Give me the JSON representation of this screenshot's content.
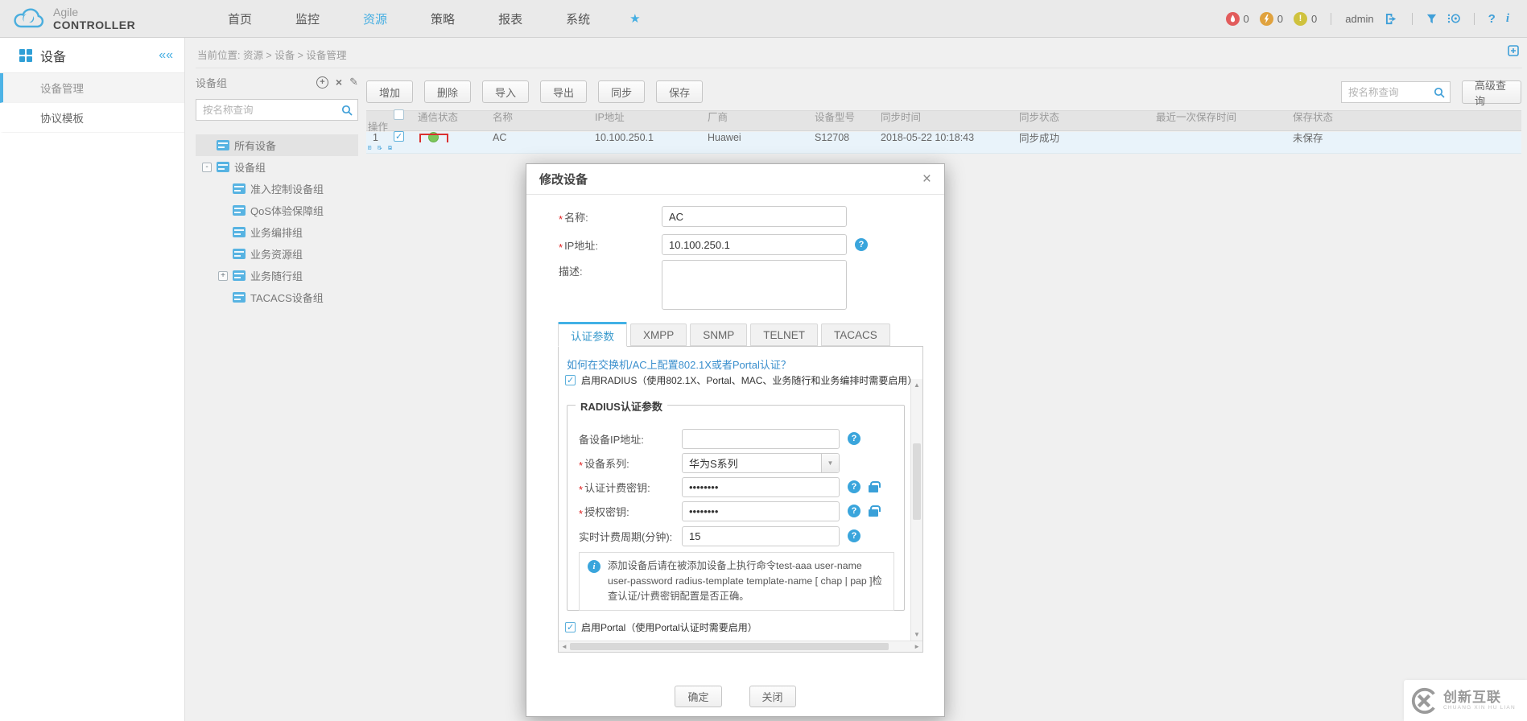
{
  "topbar": {
    "brand": {
      "line1": "Agile",
      "line2": "CONTROLLER"
    },
    "nav": [
      {
        "label": "首页",
        "active": false
      },
      {
        "label": "监控",
        "active": false
      },
      {
        "label": "资源",
        "active": true
      },
      {
        "label": "策略",
        "active": false
      },
      {
        "label": "报表",
        "active": false
      },
      {
        "label": "系统",
        "active": false
      }
    ],
    "alarms": [
      {
        "count": "0",
        "color": "#e25c5c",
        "name": "critical"
      },
      {
        "count": "0",
        "color": "#e0a23e",
        "name": "major"
      },
      {
        "count": "0",
        "color": "#cfc23e",
        "name": "minor"
      }
    ],
    "user": "admin"
  },
  "breadcrumb": "当前位置: 资源 > 设备 > 设备管理",
  "sidebar": {
    "title": "设备",
    "items": [
      {
        "label": "设备管理",
        "active": true
      },
      {
        "label": "协议模板",
        "active": false
      }
    ]
  },
  "tree_panel": {
    "title": "设备组",
    "search_placeholder": "按名称查询",
    "items": [
      {
        "label": "所有设备"
      },
      {
        "label": "设备组"
      },
      {
        "label": "准入控制设备组"
      },
      {
        "label": "QoS体验保障组"
      },
      {
        "label": "业务编排组"
      },
      {
        "label": "业务资源组"
      },
      {
        "label": "业务随行组"
      },
      {
        "label": "TACACS设备组"
      }
    ]
  },
  "toolbar": {
    "buttons": [
      "增加",
      "删除",
      "导入",
      "导出",
      "同步",
      "保存"
    ],
    "search_placeholder": "按名称查询",
    "advanced_button": "高级查询"
  },
  "table": {
    "columns": [
      "通信状态",
      "名称",
      "IP地址",
      "厂商",
      "设备型号",
      "同步时间",
      "同步状态",
      "最近一次保存时间",
      "保存状态",
      "操作"
    ],
    "rows": [
      {
        "index": "1",
        "checked": true,
        "comm_status": "online",
        "name": "AC",
        "ip": "10.100.250.1",
        "vendor": "Huawei",
        "model": "S12708",
        "sync_time": "2018-05-22 10:18:43",
        "sync_status": "同步成功",
        "last_save_time": "",
        "save_status": "未保存"
      }
    ]
  },
  "dialog": {
    "title": "修改设备",
    "fields": {
      "name_label": "名称:",
      "name_value": "AC",
      "ip_label": "IP地址:",
      "ip_value": "10.100.250.1",
      "desc_label": "描述:",
      "desc_value": ""
    },
    "tabs": [
      "认证参数",
      "XMPP",
      "SNMP",
      "TELNET",
      "TACACS"
    ],
    "auth": {
      "help_link": "如何在交换机/AC上配置802.1X或者Portal认证？",
      "radius_checkbox": "启用RADIUS（使用802.1X、Portal、MAC、业务随行和业务编排时需要启用）",
      "fieldset_legend": "RADIUS认证参数",
      "rows": [
        {
          "label": "备设备IP地址:",
          "required": false,
          "value": ""
        },
        {
          "label": "设备系列:",
          "required": true,
          "value": "华为S系列"
        },
        {
          "label": "认证计费密钥:",
          "required": true,
          "value": "••••••••"
        },
        {
          "label": "授权密钥:",
          "required": true,
          "value": "••••••••"
        },
        {
          "label": "实时计费周期(分钟):",
          "required": false,
          "value": "15"
        }
      ],
      "note": "添加设备后请在被添加设备上执行命令test-aaa user-name user-password radius-template template-name [ chap | pap ]检查认证/计费密钥配置是否正确。",
      "portal_checkbox": "启用Portal（使用Portal认证时需要启用）"
    },
    "buttons": {
      "ok": "确定",
      "close": "关闭"
    }
  },
  "watermark": {
    "title": "创新互联",
    "subtitle": "CHUANG XIN HU LIAN"
  },
  "icons": {
    "star": "★",
    "collapse": "««",
    "close": "×",
    "add": "+",
    "delete": "×",
    "edit": "✎",
    "up": "▲",
    "down": "▼",
    "left": "◄",
    "right": "►",
    "help": "?",
    "info": "i",
    "required": "*"
  },
  "colors": {
    "accent_blue": "#3f9fd8",
    "nav_active": "#45aee2",
    "status_green": "#7cc75a",
    "annotation_red": "#db2f2f",
    "link_blue": "#3a8fcd"
  }
}
